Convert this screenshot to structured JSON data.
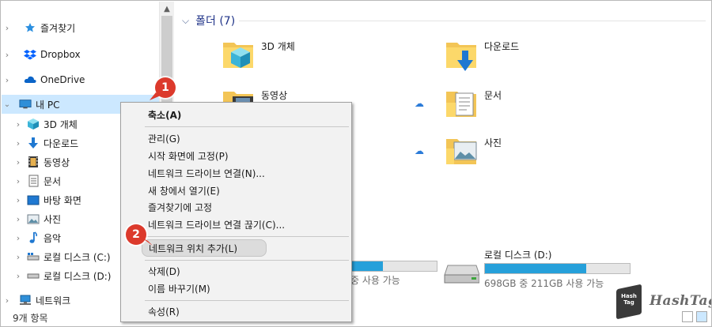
{
  "nav": {
    "items": [
      {
        "label": "즐겨찾기",
        "icon": "star-icon"
      },
      {
        "label": "Dropbox",
        "icon": "dropbox-icon"
      },
      {
        "label": "OneDrive",
        "icon": "onedrive-icon"
      },
      {
        "label": "내 PC",
        "icon": "pc-icon"
      },
      {
        "label": "3D 개체",
        "icon": "3d-objects-icon"
      },
      {
        "label": "다운로드",
        "icon": "download-icon"
      },
      {
        "label": "동영상",
        "icon": "video-icon"
      },
      {
        "label": "문서",
        "icon": "document-icon"
      },
      {
        "label": "바탕 화면",
        "icon": "desktop-icon"
      },
      {
        "label": "사진",
        "icon": "picture-icon"
      },
      {
        "label": "음악",
        "icon": "music-icon"
      },
      {
        "label": "로컬 디스크 (C:)",
        "icon": "drive-c-icon"
      },
      {
        "label": "로컬 디스크 (D:)",
        "icon": "drive-d-icon"
      },
      {
        "label": "네트워크",
        "icon": "network-icon"
      }
    ]
  },
  "content": {
    "group_title": "폴더 (7)",
    "folders": [
      {
        "label": "3D 개체",
        "icon": "folder-3d-icon"
      },
      {
        "label": "다운로드",
        "icon": "folder-download-icon"
      },
      {
        "label": "동영상",
        "icon": "folder-video-icon"
      },
      {
        "label": "문서",
        "icon": "folder-document-icon"
      },
      {
        "label": "사진",
        "icon": "folder-picture-icon"
      }
    ],
    "drives": [
      {
        "label": "",
        "sub": "중 사용 가능",
        "used_fraction": 0.37
      },
      {
        "label": "로컬 디스크 (D:)",
        "sub": "698GB 중 211GB 사용 가능",
        "used_fraction": 0.7
      }
    ]
  },
  "context_menu": {
    "items": [
      {
        "label": "축소(A)",
        "bold": true
      },
      {
        "label": "관리(G)"
      },
      {
        "label": "시작 화면에 고정(P)"
      },
      {
        "label": "네트워크 드라이브 연결(N)..."
      },
      {
        "label": "새 창에서 열기(E)"
      },
      {
        "label": "즐겨찾기에 고정"
      },
      {
        "label": "네트워크 드라이브 연결 끊기(C)..."
      },
      {
        "label": "네트워크 위치 추가(L)"
      },
      {
        "label": "삭제(D)"
      },
      {
        "label": "이름 바꾸기(M)"
      },
      {
        "label": "속성(R)"
      }
    ]
  },
  "badges": [
    "1",
    "2"
  ],
  "status": {
    "count": "9개 항목"
  },
  "watermark": {
    "logo_text": "Hash Tag",
    "text": "HashTag"
  },
  "colors": {
    "selection": "#cce8ff",
    "badge": "#dc3a2c",
    "accent": "#26a0da",
    "group_title": "#1e3287"
  }
}
